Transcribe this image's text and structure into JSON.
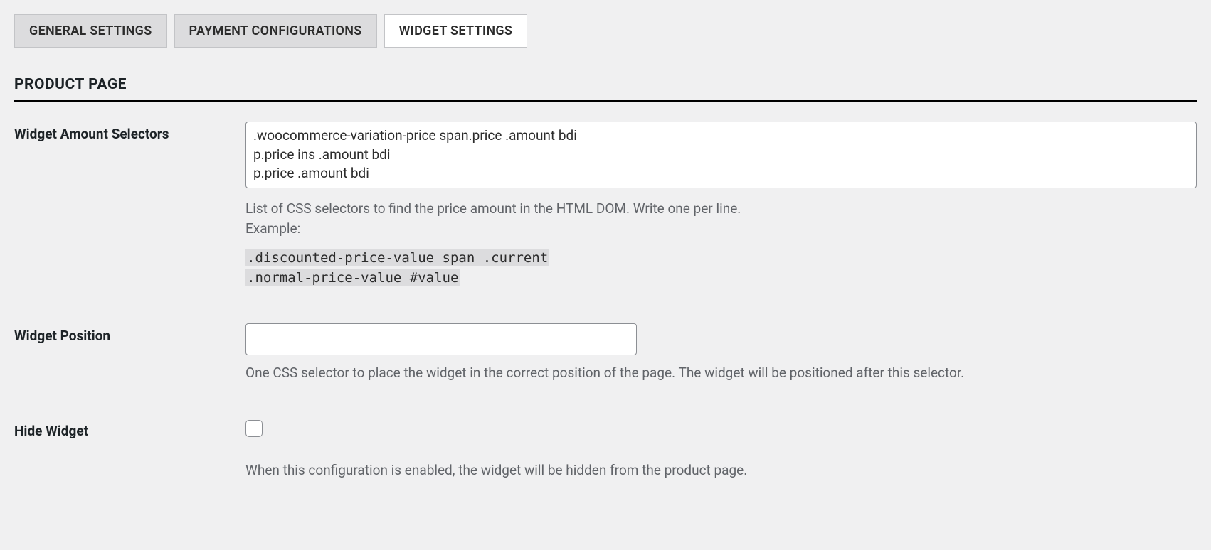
{
  "tabs": {
    "general": "GENERAL SETTINGS",
    "payment": "PAYMENT CONFIGURATIONS",
    "widget": "WIDGET SETTINGS"
  },
  "section": {
    "title": "PRODUCT PAGE"
  },
  "fields": {
    "amountSelectors": {
      "label": "Widget Amount Selectors",
      "value": ".woocommerce-variation-price span.price .amount bdi\np.price ins .amount bdi\np.price .amount bdi",
      "help1": "List of CSS selectors to find the price amount in the HTML DOM. Write one per line.",
      "help2": "Example:",
      "example1": ".discounted-price-value span .current",
      "example2": ".normal-price-value #value"
    },
    "position": {
      "label": "Widget Position",
      "value": "",
      "help": "One CSS selector to place the widget in the correct position of the page. The widget will be positioned after this selector."
    },
    "hide": {
      "label": "Hide Widget",
      "help": "When this configuration is enabled, the widget will be hidden from the product page."
    }
  }
}
